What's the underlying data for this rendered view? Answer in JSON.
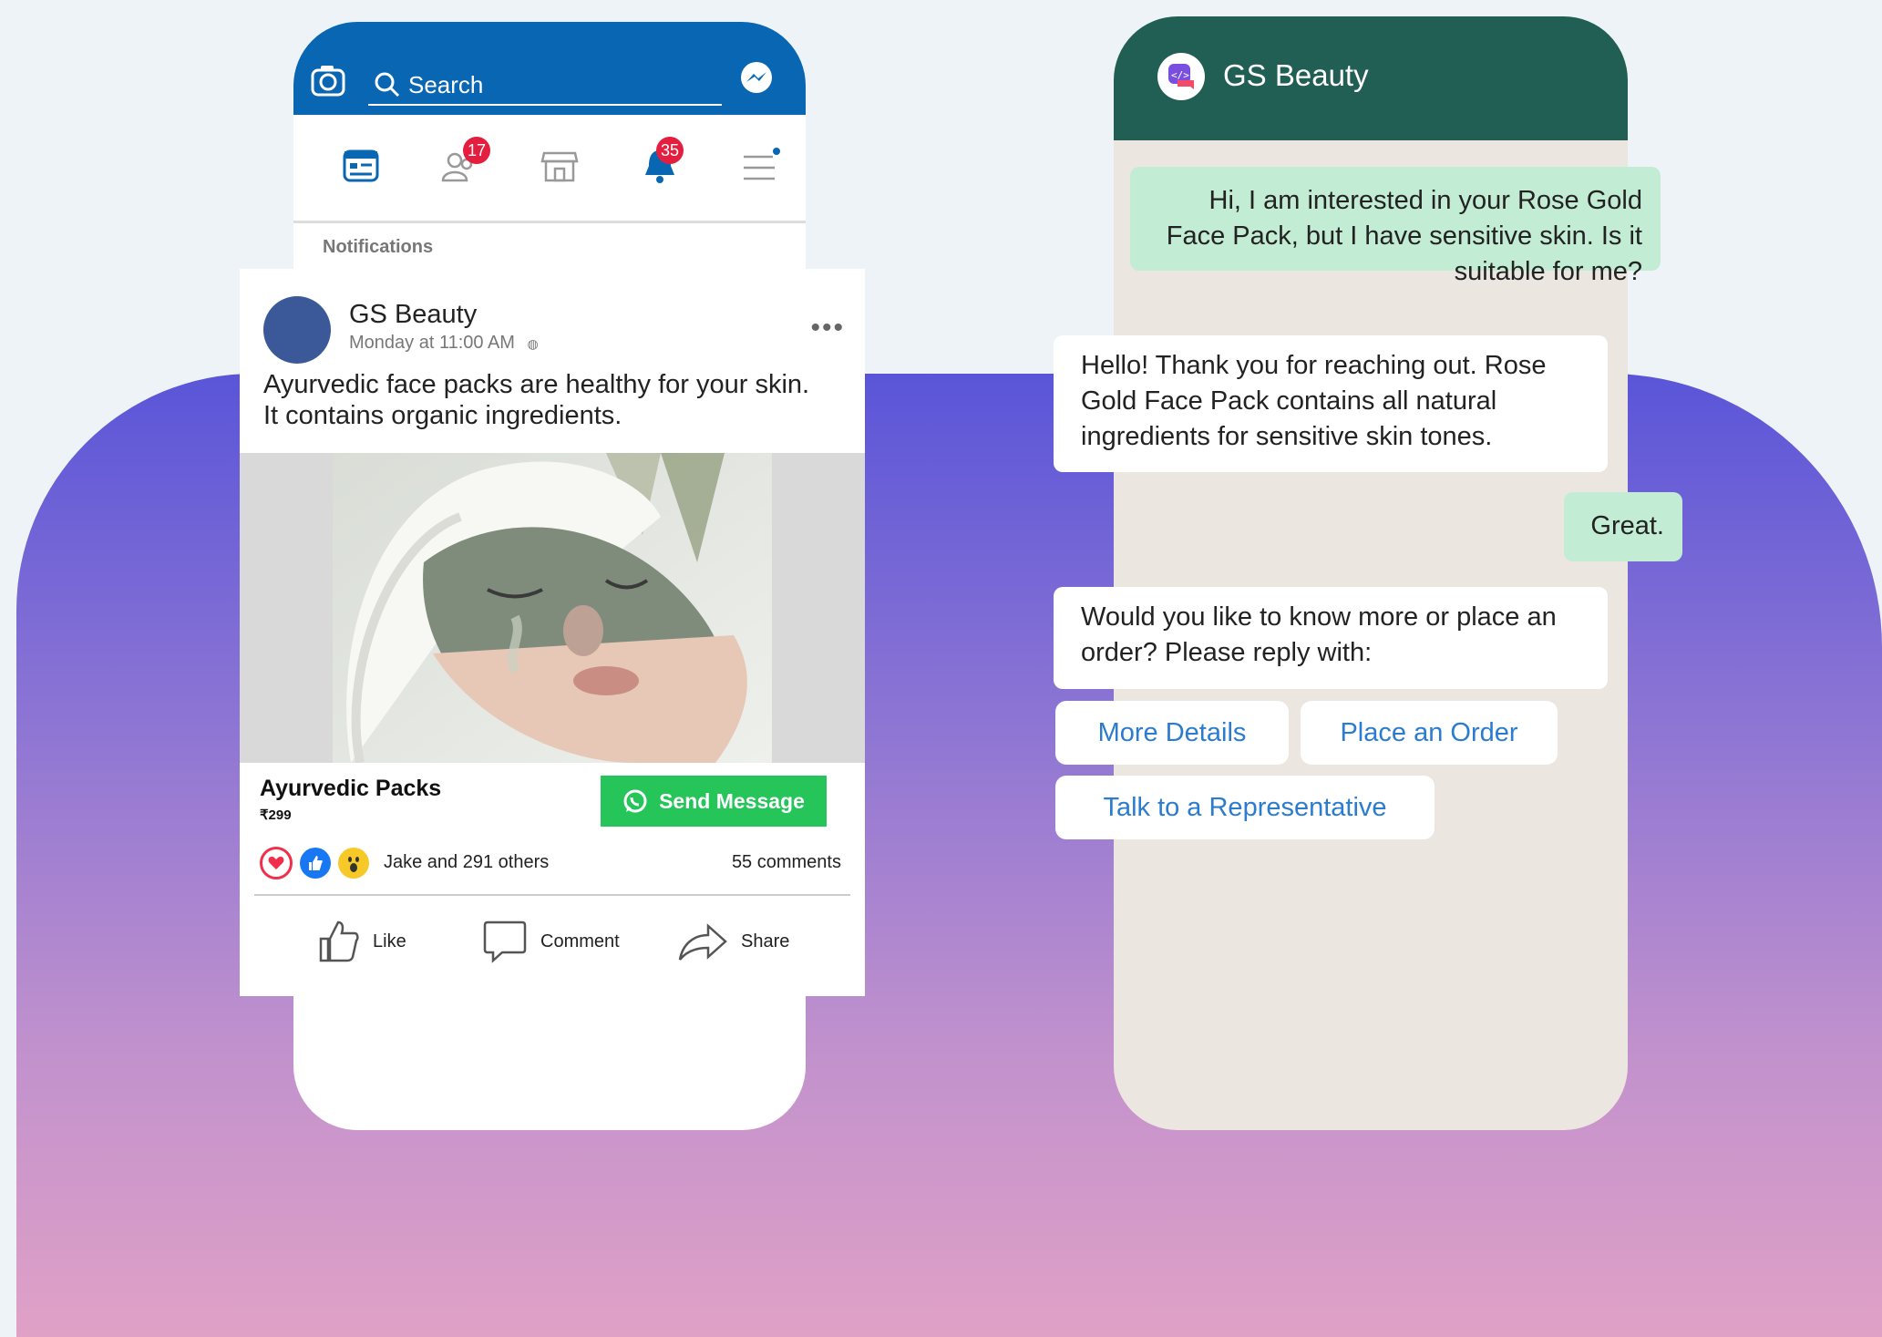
{
  "facebook": {
    "search_placeholder": "Search",
    "nav": {
      "friends_badge": "17",
      "notifications_badge": "35"
    },
    "notifications_label": "Notifications",
    "post": {
      "page_name": "GS Beauty",
      "timestamp": "Monday at 11:00 AM",
      "text": "Ayurvedic face packs are healthy for your skin. It contains organic ingredients.",
      "product_name": "Ayurvedic Packs",
      "product_price": "₹299",
      "cta_label": "Send Message",
      "likers": "Jake and 291 others",
      "comments": "55 comments",
      "actions": {
        "like": "Like",
        "comment": "Comment",
        "share": "Share"
      }
    }
  },
  "whatsapp": {
    "contact": "GS Beauty",
    "messages": [
      {
        "from": "user",
        "text": "Hi, I am interested in your Rose Gold Face Pack, but I have sensitive skin. Is it suitable for me?"
      },
      {
        "from": "business",
        "text": "Hello! Thank you for reaching out. Rose Gold Face Pack contains all natural ingredients for sensitive skin tones."
      },
      {
        "from": "user",
        "text": "Great."
      },
      {
        "from": "business",
        "text": "Would you like to know more or place an order? Please reply with:"
      }
    ],
    "quick_replies": [
      "More Details",
      "Place an Order",
      "Talk to a Representative"
    ]
  },
  "colors": {
    "fb_blue": "#0866b3",
    "wa_header": "#215f55",
    "wa_outgoing": "#c2ecd3",
    "send_button": "#25c55a",
    "badge_red": "#e41e3f"
  }
}
